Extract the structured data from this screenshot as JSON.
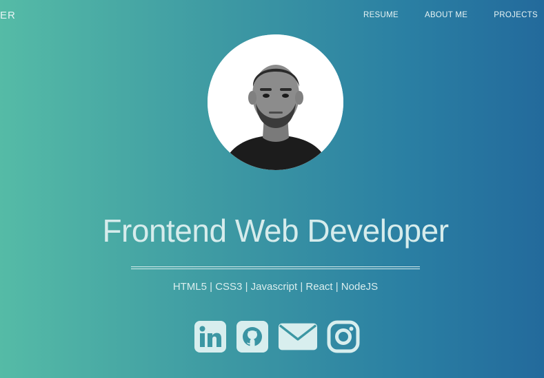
{
  "nav": {
    "brand": "ER",
    "links": [
      {
        "label": "RESUME"
      },
      {
        "label": "ABOUT ME"
      },
      {
        "label": "PROJECTS"
      }
    ]
  },
  "hero": {
    "title": "Frontend Web Developer",
    "skills": "HTML5 | CSS3 | Javascript | React | NodeJS"
  },
  "socials": [
    {
      "icon": "linkedin-icon"
    },
    {
      "icon": "github-icon"
    },
    {
      "icon": "mail-icon"
    },
    {
      "icon": "instagram-icon"
    }
  ],
  "colors": {
    "gradient_left": "#55bba6",
    "gradient_right": "#236a9c",
    "text": "#d6ecec"
  }
}
